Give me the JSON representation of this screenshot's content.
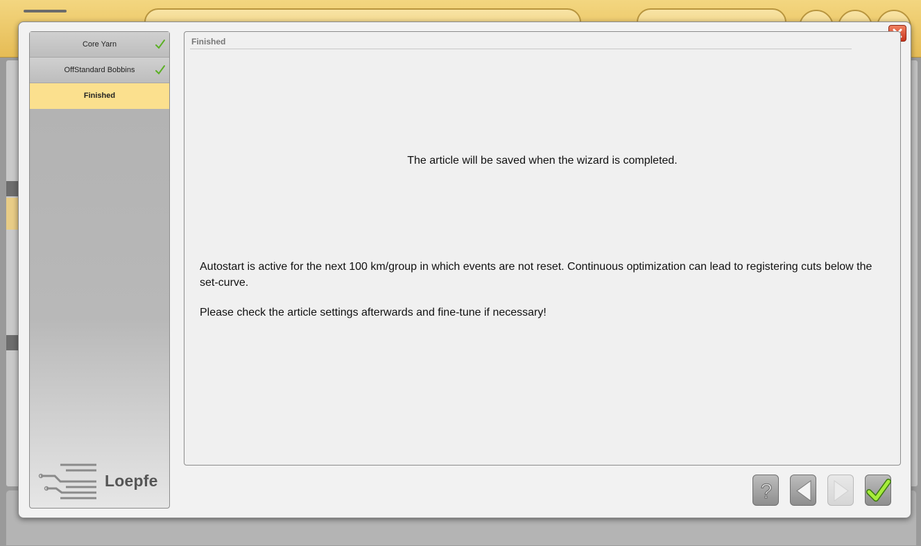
{
  "dialog": {
    "steps": [
      {
        "label": "Core Yarn",
        "state": "done",
        "icon": "checkmark-icon"
      },
      {
        "label": "OffStandard Bobbins",
        "state": "done",
        "icon": "checkmark-icon"
      },
      {
        "label": "Finished",
        "state": "active"
      }
    ],
    "logo_text": "Loepfe",
    "content": {
      "header": "Finished",
      "main_message": "The article will be saved when the wizard is completed.",
      "paragraphs": [
        "Autostart is active for the next 100 km/group in which events are not reset. Continuous optimization can lead to registering cuts below the set-curve.",
        "Please check the article settings afterwards and fine-tune if necessary!"
      ]
    },
    "buttons": {
      "help_icon": "question-mark-icon",
      "back_icon": "arrow-left-icon",
      "next_icon": "arrow-right-icon",
      "finish_icon": "checkmark-icon",
      "close_icon": "close-x-icon"
    }
  },
  "colors": {
    "active_step": "#fbe08e",
    "header_gold": "#e6bc55",
    "check_green": "#6fc22a",
    "close_red": "#d04020"
  }
}
